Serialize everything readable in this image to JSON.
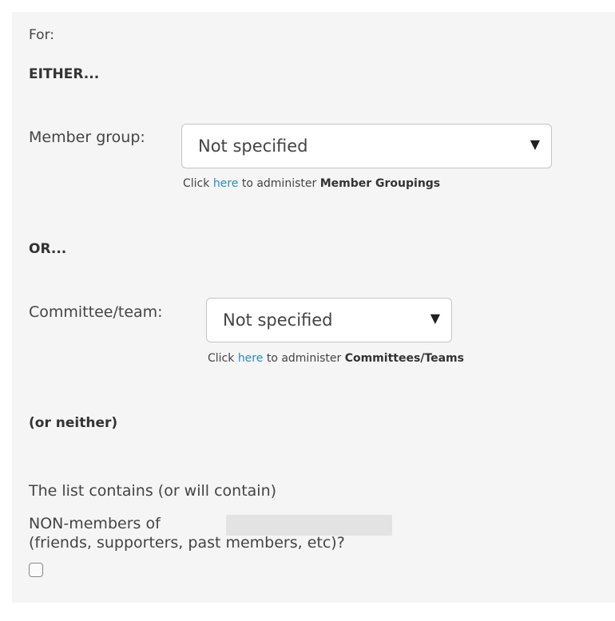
{
  "form": {
    "for_label": "For:",
    "either_label": "EITHER...",
    "member_group": {
      "label": "Member group:",
      "selected": "Not specified",
      "help_prefix": "Click",
      "help_link": "here",
      "help_middle": "to administer",
      "help_target": "Member Groupings"
    },
    "or_label": "OR...",
    "committee": {
      "label": "Committee/team:",
      "selected": "Not specified",
      "help_prefix": "Click",
      "help_link": "here",
      "help_middle": "to administer",
      "help_target": "Committees/Teams"
    },
    "neither_label": "(or neither)",
    "nonmembers": {
      "line1": "The list contains (or will contain)",
      "line2": "NON-members of",
      "line3": "(friends, supporters, past members, etc)?",
      "checked": false
    },
    "icons": {
      "dropdown": "triangle-down-icon"
    }
  }
}
